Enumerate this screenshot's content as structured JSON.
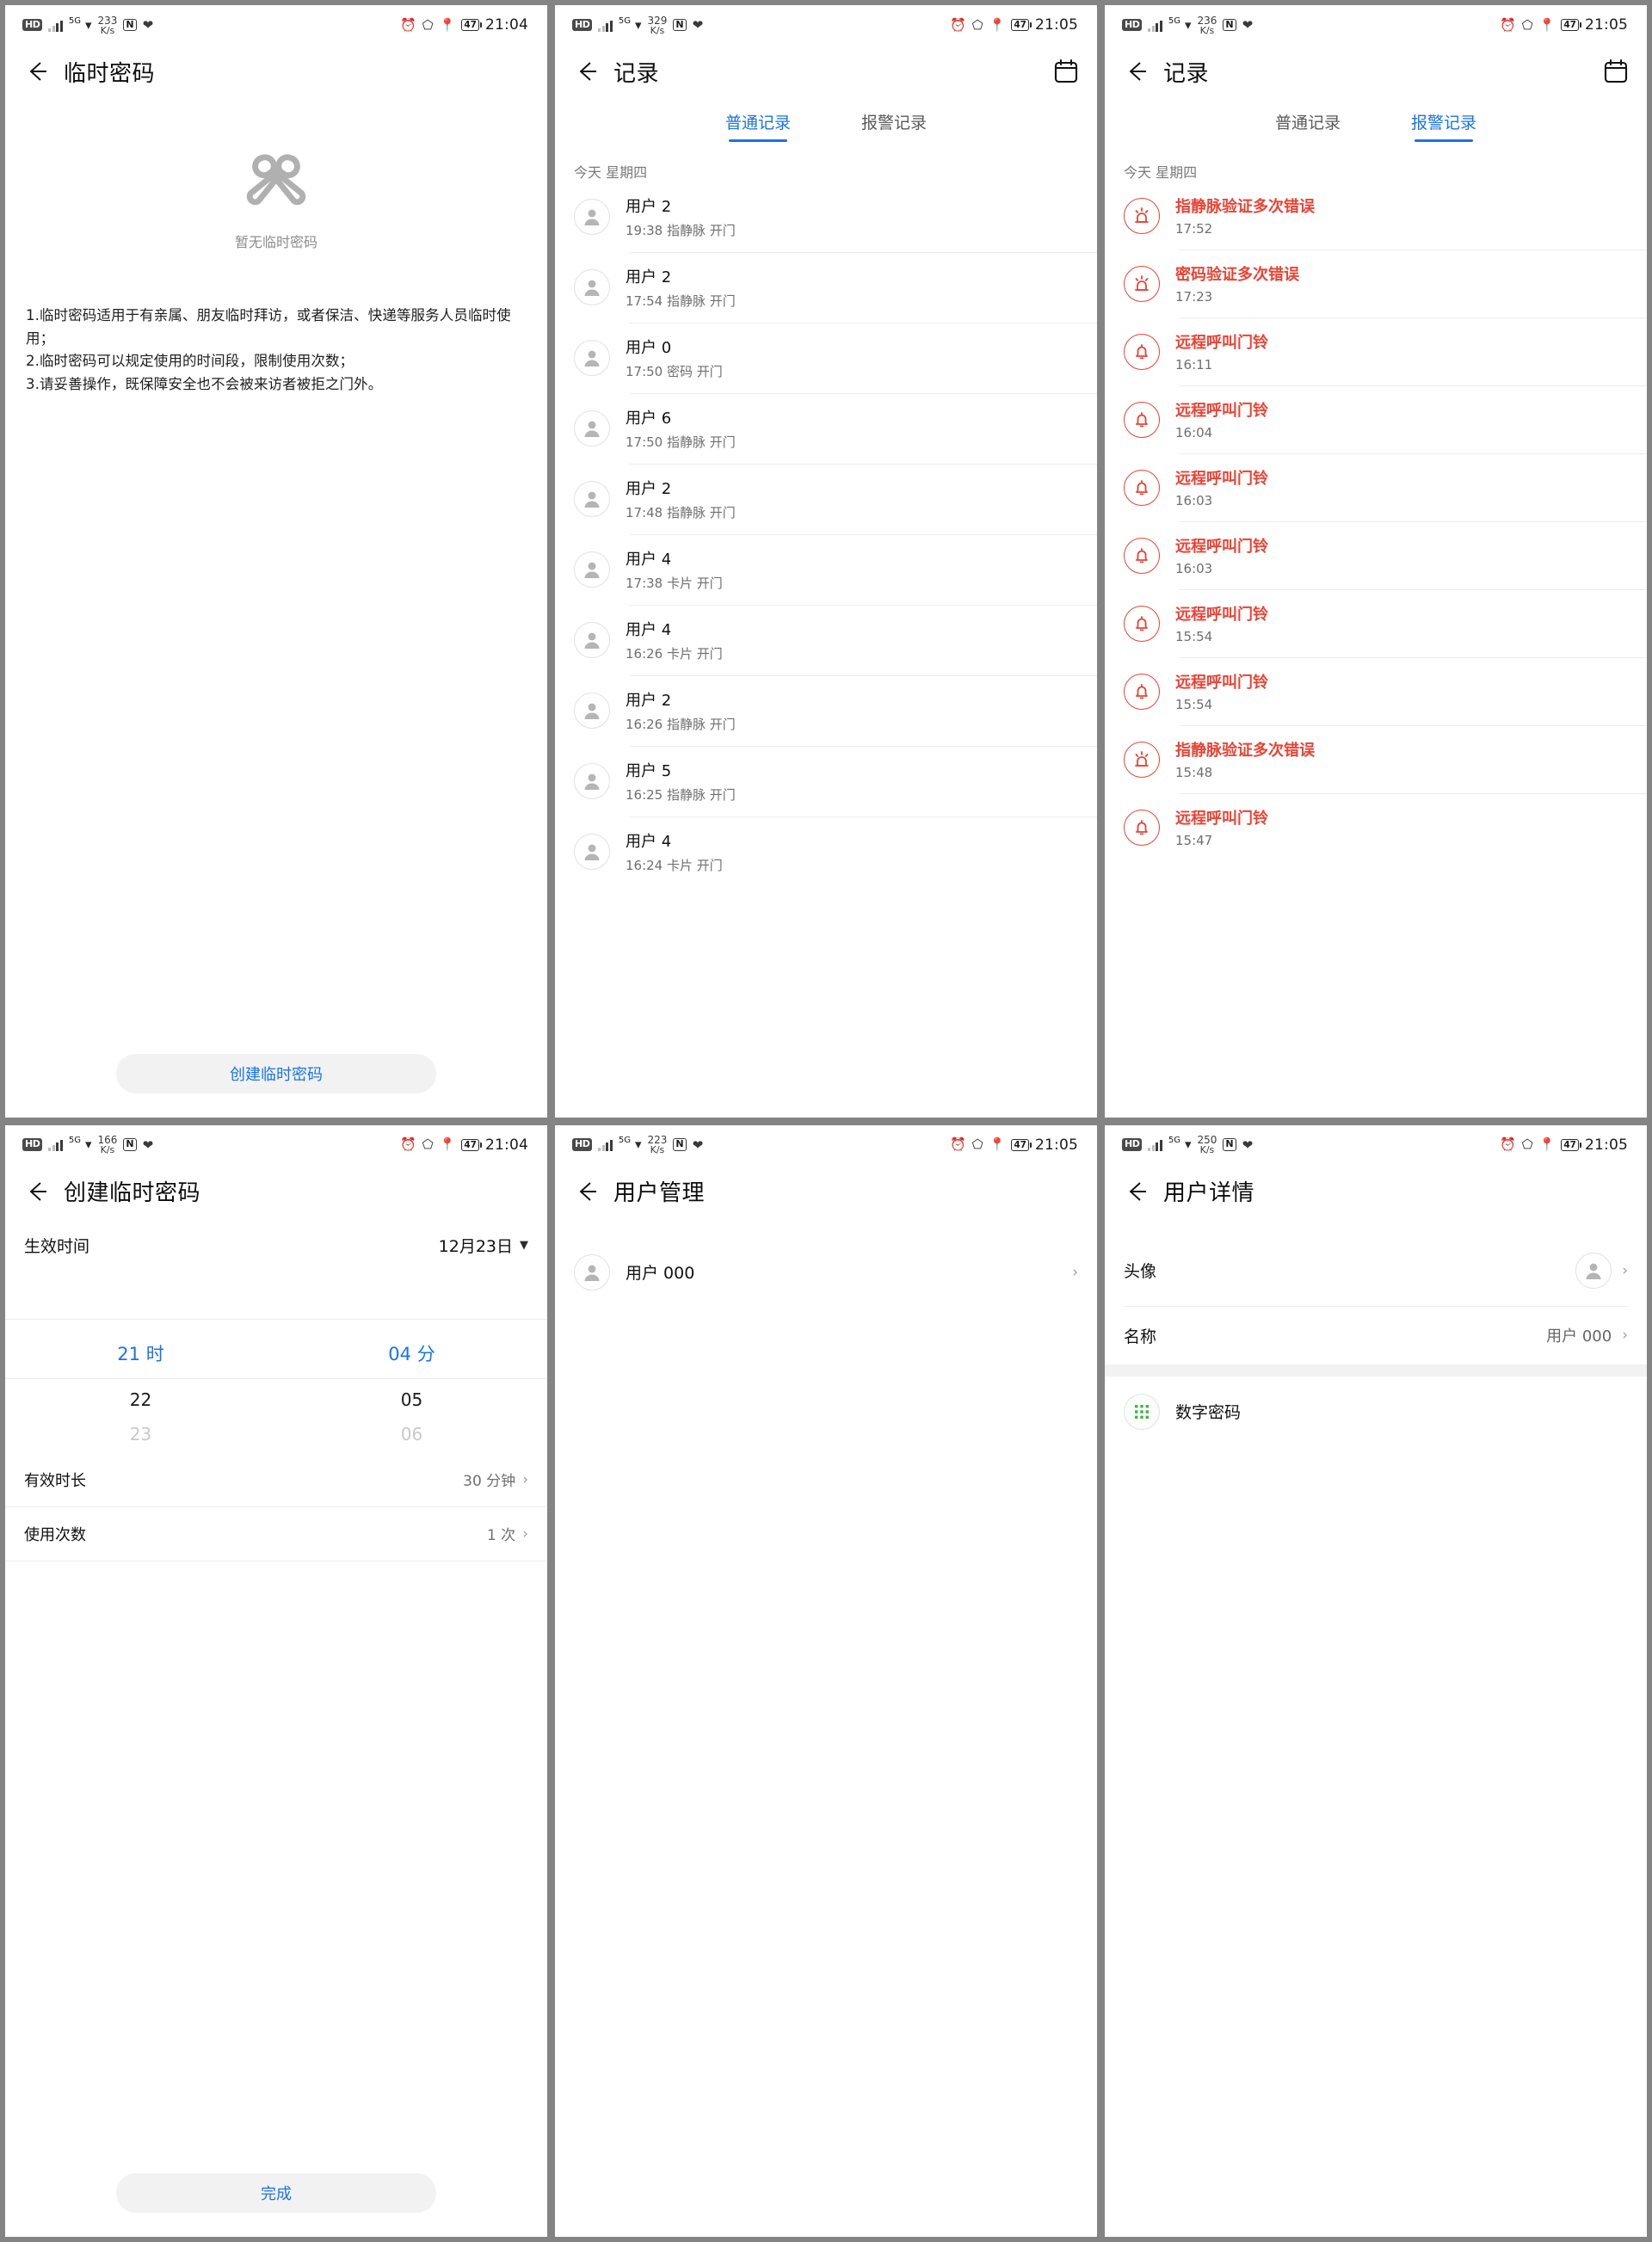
{
  "statusbar": {
    "hd": "HD",
    "net_label": "5G",
    "nfc": "N",
    "speed_unit": "K/s",
    "battery": "47",
    "panels": [
      {
        "speed": "233",
        "time": "21:04"
      },
      {
        "speed": "329",
        "time": "21:05"
      },
      {
        "speed": "236",
        "time": "21:05"
      },
      {
        "speed": "166",
        "time": "21:04"
      },
      {
        "speed": "223",
        "time": "21:05"
      },
      {
        "speed": "250",
        "time": "21:05"
      }
    ]
  },
  "colors": {
    "accent_blue": "#1a73e8",
    "alarm_red": "#ea4335",
    "muted_gray": "#6f6f6f",
    "divider": "#ededed",
    "pill_bg": "#f2f2f2"
  },
  "panel1": {
    "title": "临时密码",
    "empty_text": "暂无临时密码",
    "notes": "1.临时密码适用于有亲属、朋友临时拜访，或者保洁、快递等服务人员临时使用；\n2.临时密码可以规定使用的时间段，限制使用次数；\n3.请妥善操作，既保障安全也不会被来访者被拒之门外。",
    "button": "创建临时密码"
  },
  "panel2": {
    "title": "记录",
    "tabs": [
      {
        "label": "普通记录",
        "active": true
      },
      {
        "label": "报警记录",
        "active": false
      }
    ],
    "day_label": "今天 星期四",
    "records": [
      {
        "name": "用户 2",
        "detail": "19:38 指静脉 开门"
      },
      {
        "name": "用户 2",
        "detail": "17:54 指静脉 开门"
      },
      {
        "name": "用户 0",
        "detail": "17:50 密码 开门"
      },
      {
        "name": "用户 6",
        "detail": "17:50 指静脉 开门"
      },
      {
        "name": "用户 2",
        "detail": "17:48 指静脉 开门"
      },
      {
        "name": "用户 4",
        "detail": "17:38 卡片 开门"
      },
      {
        "name": "用户 4",
        "detail": "16:26 卡片 开门"
      },
      {
        "name": "用户 2",
        "detail": "16:26 指静脉 开门"
      },
      {
        "name": "用户 5",
        "detail": "16:25 指静脉 开门"
      },
      {
        "name": "用户 4",
        "detail": "16:24 卡片 开门"
      }
    ]
  },
  "panel3": {
    "title": "记录",
    "tabs": [
      {
        "label": "普通记录",
        "active": false
      },
      {
        "label": "报警记录",
        "active": true
      }
    ],
    "day_label": "今天 星期四",
    "alarms": [
      {
        "title": "指静脉验证多次错误",
        "time": "17:52",
        "icon": "siren-icon"
      },
      {
        "title": "密码验证多次错误",
        "time": "17:23",
        "icon": "siren-icon"
      },
      {
        "title": "远程呼叫门铃",
        "time": "16:11",
        "icon": "bell-icon"
      },
      {
        "title": "远程呼叫门铃",
        "time": "16:04",
        "icon": "bell-icon"
      },
      {
        "title": "远程呼叫门铃",
        "time": "16:03",
        "icon": "bell-icon"
      },
      {
        "title": "远程呼叫门铃",
        "time": "16:03",
        "icon": "bell-icon"
      },
      {
        "title": "远程呼叫门铃",
        "time": "15:54",
        "icon": "bell-icon"
      },
      {
        "title": "远程呼叫门铃",
        "time": "15:54",
        "icon": "bell-icon"
      },
      {
        "title": "指静脉验证多次错误",
        "time": "15:48",
        "icon": "siren-icon"
      },
      {
        "title": "远程呼叫门铃",
        "time": "15:47",
        "icon": "bell-icon"
      }
    ]
  },
  "panel4": {
    "title": "创建临时密码",
    "effective_label": "生效时间",
    "effective_value": "12月23日",
    "hour_selected": "21 时",
    "hour_next1": "22",
    "hour_next2": "23",
    "minute_selected": "04 分",
    "minute_next1": "05",
    "minute_next2": "06",
    "duration_label": "有效时长",
    "duration_value": "30 分钟",
    "uses_label": "使用次数",
    "uses_value": "1 次",
    "button": "完成"
  },
  "panel5": {
    "title": "用户管理",
    "users": [
      {
        "name": "用户 000"
      }
    ]
  },
  "panel6": {
    "title": "用户详情",
    "avatar_label": "头像",
    "name_label": "名称",
    "name_value": "用户 000",
    "password_label": "数字密码"
  }
}
